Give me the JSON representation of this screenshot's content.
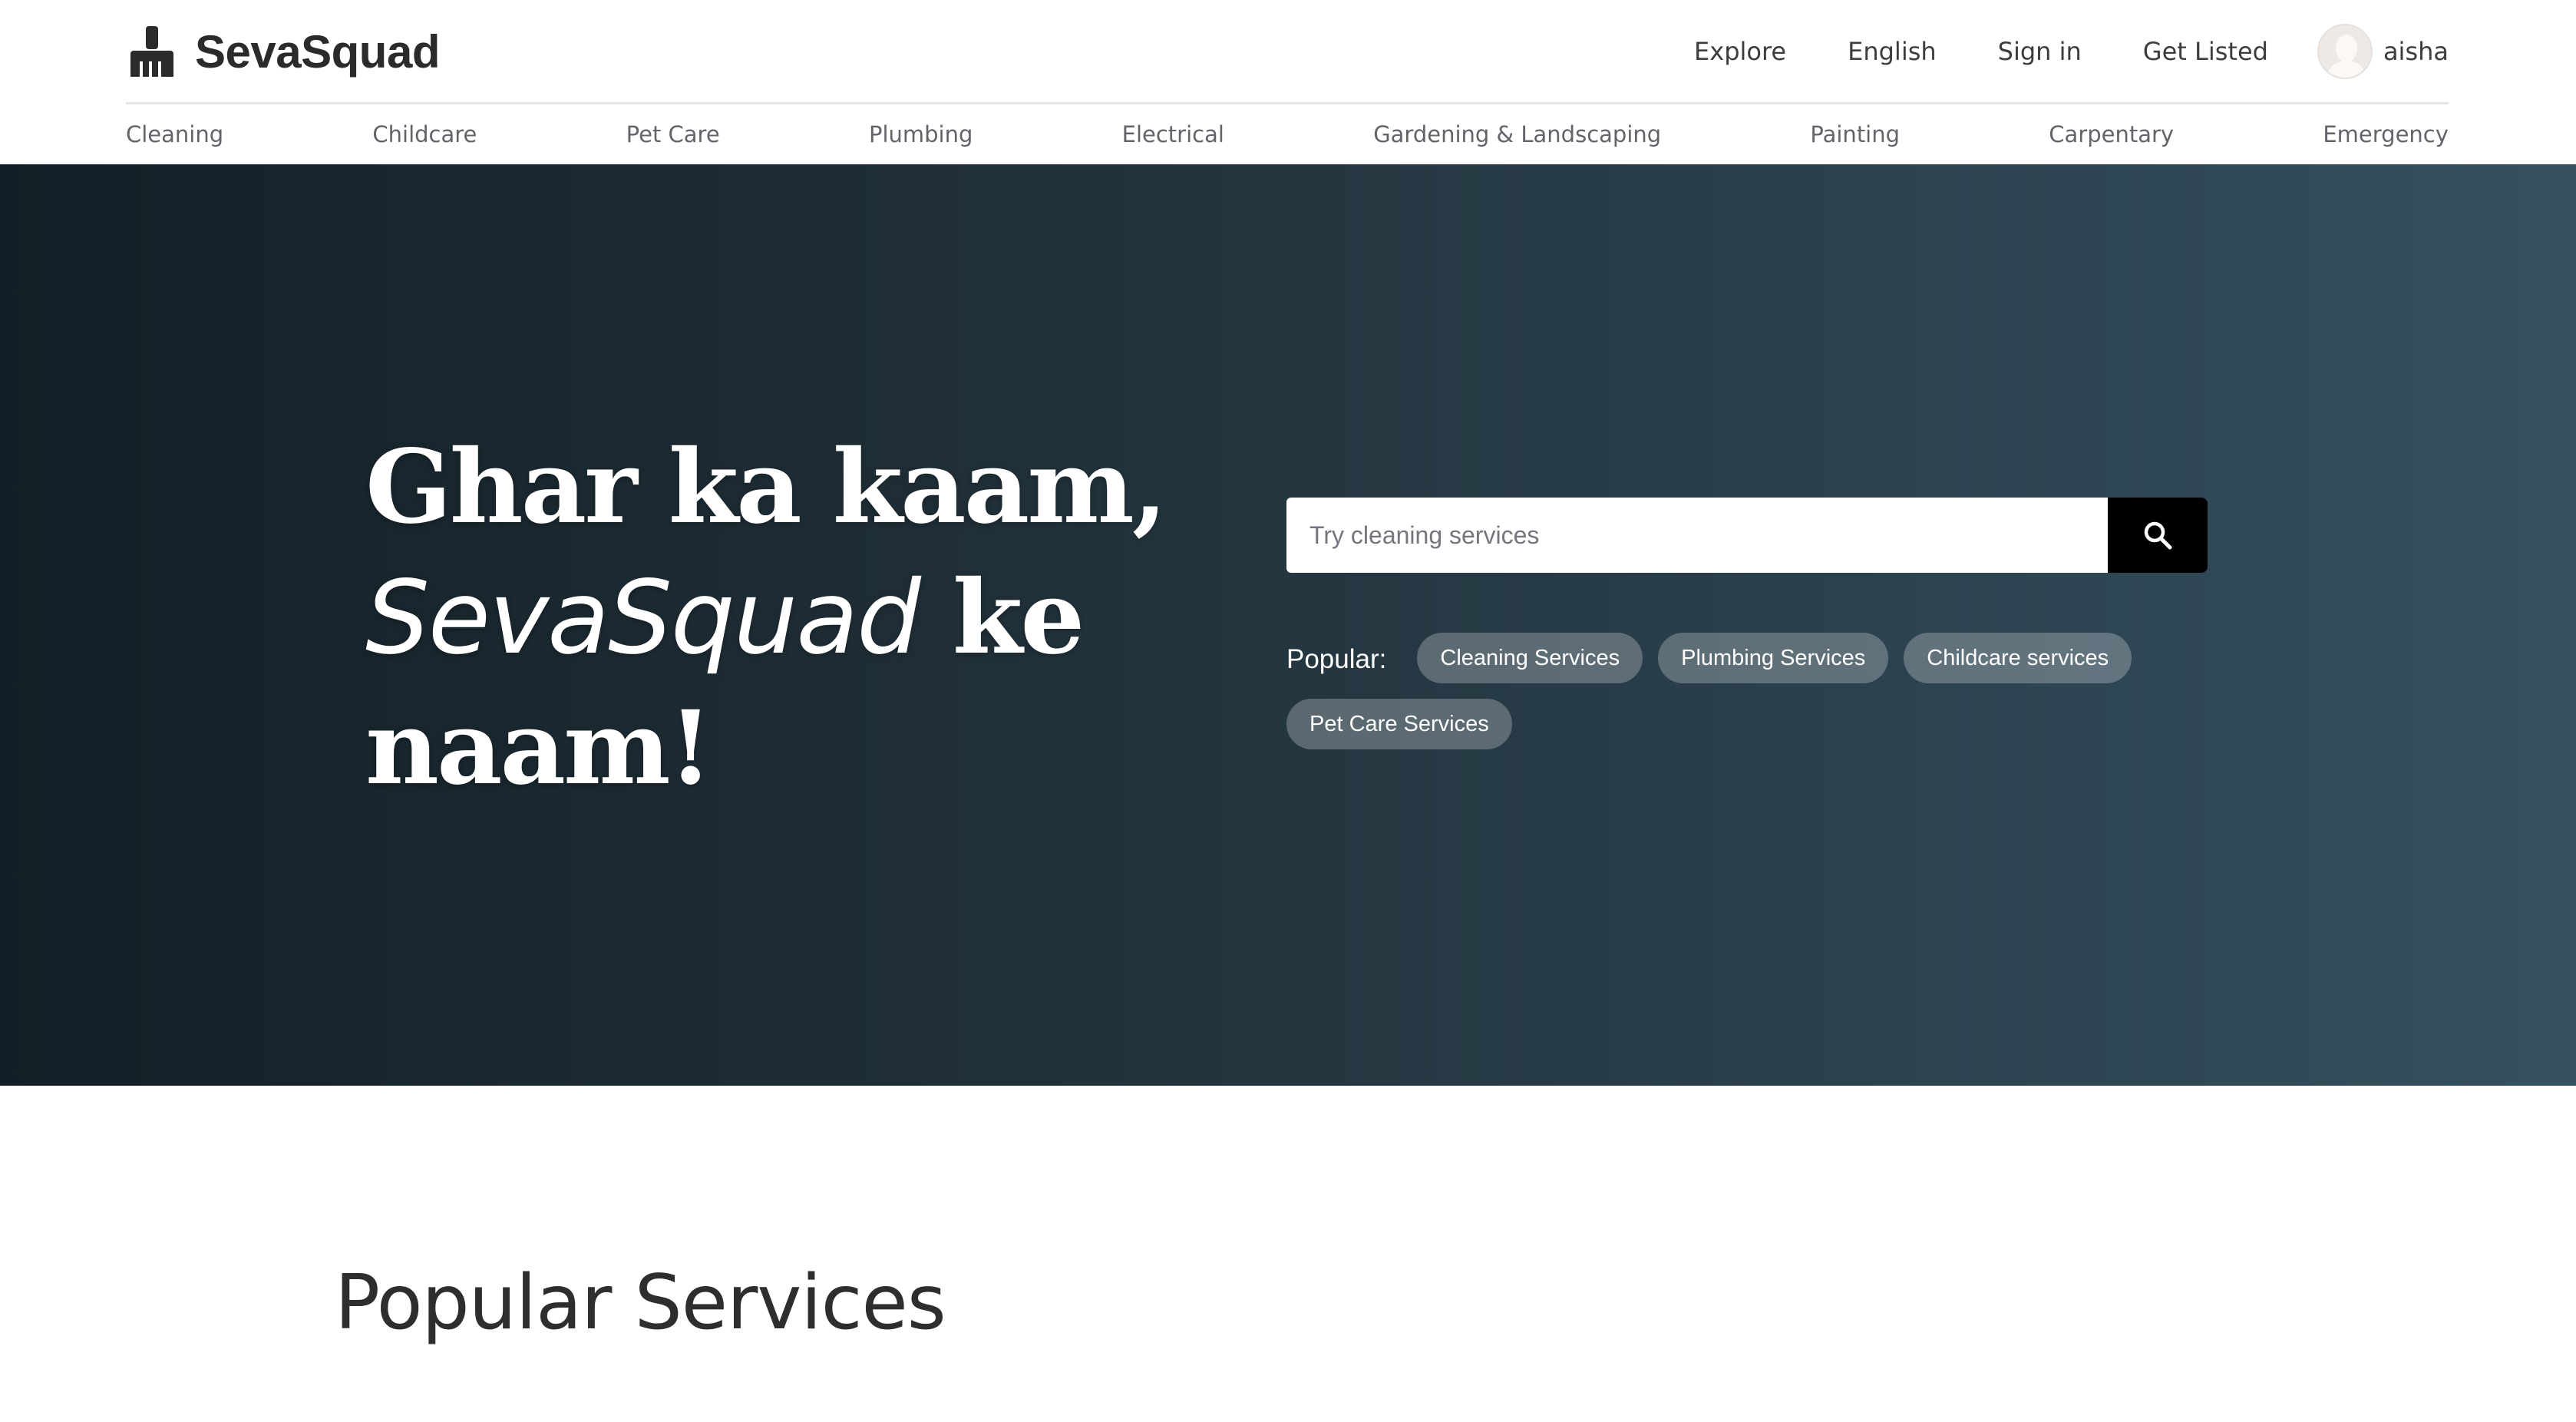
{
  "brand": {
    "name": "SevaSquad",
    "logo_icon": "broom-icon"
  },
  "topnav": {
    "explore": "Explore",
    "language": "English",
    "sign_in": "Sign in",
    "get_listed": "Get Listed",
    "user_name": "aisha",
    "avatar_icon": "user-avatar-icon"
  },
  "categories": [
    "Cleaning",
    "Childcare",
    "Pet Care",
    "Plumbing",
    "Electrical",
    "Gardening & Landscaping",
    "Painting",
    "Carpentary",
    "Emergency"
  ],
  "hero": {
    "title_line1": "Ghar ka kaam,",
    "title_brand": "SevaSquad",
    "title_line2_rest": " ke",
    "title_line3": "naam!",
    "search_placeholder": "Try cleaning services",
    "search_icon": "search-icon",
    "popular_label": "Popular:",
    "popular_tags": [
      "Cleaning Services",
      "Plumbing Services",
      "Childcare services",
      "Pet Care Services"
    ]
  },
  "sections": {
    "popular_services_title": "Popular Services"
  },
  "colors": {
    "hero_gradient_start": "#131f26",
    "hero_gradient_end": "#35505f",
    "search_button": "#000000",
    "text_dark": "#2e2e2e",
    "category_text": "#62646a"
  }
}
